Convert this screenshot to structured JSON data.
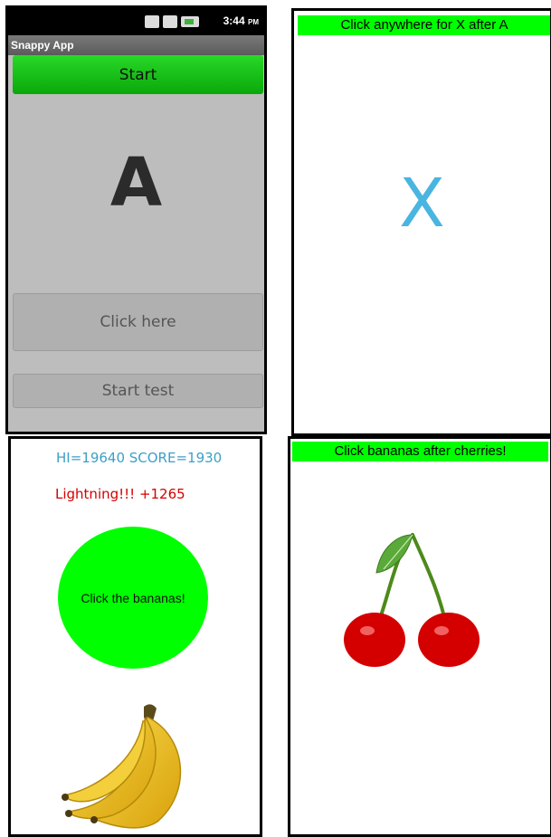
{
  "panel1": {
    "clock": "3:44",
    "clock_suffix": "PM",
    "app_title": "Snappy App",
    "start_label": "Start",
    "big_letter": "A",
    "click_here_label": "Click here",
    "start_test_label": "Start test"
  },
  "panel2": {
    "banner": "Click anywhere for X after A",
    "letter": "X",
    "letter_color": "#49b5e0"
  },
  "panel3": {
    "score_text": "HI=19640 SCORE=1930",
    "bonus_text": "Lightning!!! +1265",
    "circle_label": "Click the bananas!",
    "image": "bananas-icon"
  },
  "panel4": {
    "banner": "Click bananas after cherries!",
    "image": "cherries-icon"
  },
  "colors": {
    "accent_green": "#00ff00",
    "score_blue": "#3ca0c8",
    "bonus_red": "#d40000"
  }
}
